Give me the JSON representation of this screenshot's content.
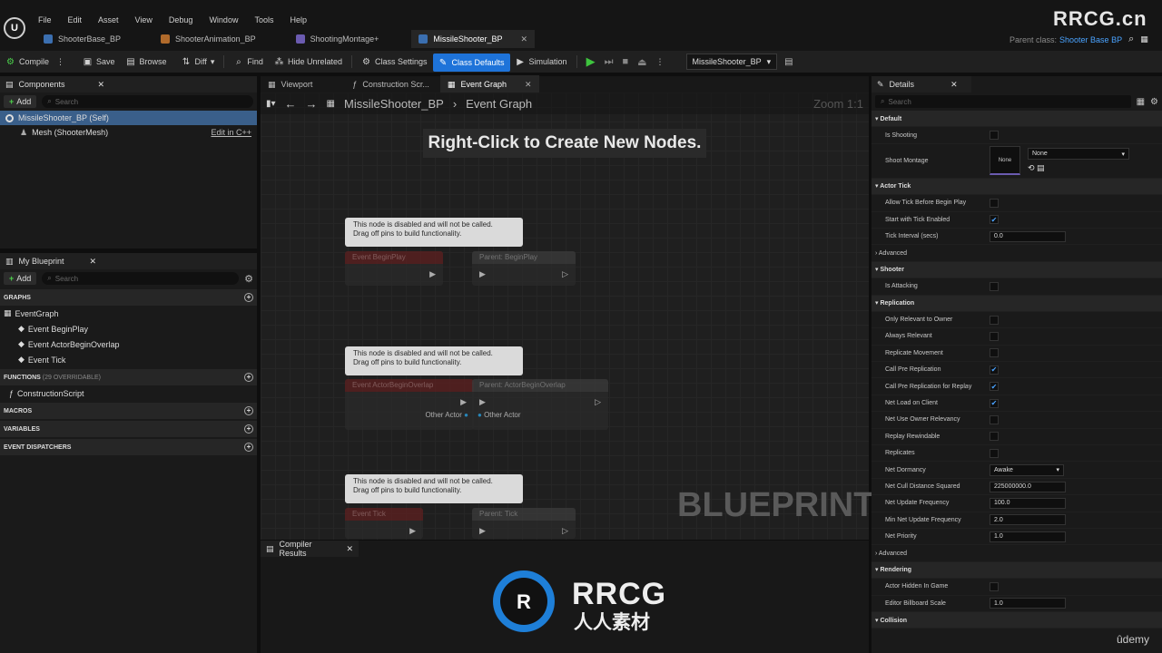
{
  "menu": [
    "File",
    "Edit",
    "Asset",
    "View",
    "Debug",
    "Window",
    "Tools",
    "Help"
  ],
  "tabs": [
    {
      "label": "ShooterBase_BP"
    },
    {
      "label": "ShooterAnimation_BP"
    },
    {
      "label": "ShootingMontage+"
    },
    {
      "label": "MissileShooter_BP"
    }
  ],
  "watermark": "RRCG.cn",
  "parent_class_label": "Parent class:",
  "parent_class_value": "Shooter Base BP",
  "toolbar": {
    "compile": "Compile",
    "save": "Save",
    "browse": "Browse",
    "diff": "Diff",
    "find": "Find",
    "hide_unrelated": "Hide Unrelated",
    "class_settings": "Class Settings",
    "class_defaults": "Class Defaults",
    "simulation": "Simulation",
    "debug_target": "MissileShooter_BP"
  },
  "components": {
    "title": "Components",
    "add": "Add",
    "search_placeholder": "Search",
    "self": "MissileShooter_BP (Self)",
    "mesh": "Mesh (ShooterMesh)",
    "edit_cpp": "Edit in C++"
  },
  "my_blueprint": {
    "title": "My Blueprint",
    "add": "Add",
    "search_placeholder": "Search",
    "graphs": "GRAPHS",
    "event_graph": "EventGraph",
    "events": [
      "Event BeginPlay",
      "Event ActorBeginOverlap",
      "Event Tick"
    ],
    "functions": "FUNCTIONS",
    "functions_note": "(29 OVERRIDABLE)",
    "construction_script": "ConstructionScript",
    "macros": "MACROS",
    "variables": "VARIABLES",
    "event_dispatchers": "EVENT DISPATCHERS"
  },
  "editor_tabs": {
    "viewport": "Viewport",
    "construction": "Construction Scr...",
    "event_graph": "Event Graph"
  },
  "breadcrumb": {
    "bp": "MissileShooter_BP",
    "graph": "Event Graph"
  },
  "zoom": "Zoom 1:1",
  "hint": "Right-Click to Create New Nodes.",
  "graph_watermark": "BLUEPRINT",
  "disabled_note_1": "This node is disabled and will not be called.",
  "disabled_note_2": "Drag off pins to build functionality.",
  "nodes": {
    "begin": "Event BeginPlay",
    "parent_begin": "Parent: BeginPlay",
    "overlap": "Event ActorBeginOverlap",
    "parent_overlap": "Parent: ActorBeginOverlap",
    "other_actor": "Other Actor",
    "tick": "Event Tick",
    "parent_tick": "Parent: Tick"
  },
  "compiler_results": "Compiler Results",
  "details": {
    "title": "Details",
    "search_placeholder": "Search",
    "rows": [
      {
        "type": "sec",
        "label": "Default"
      },
      {
        "type": "cb",
        "label": "Is Shooting",
        "checked": false
      },
      {
        "type": "montage",
        "label": "Shoot Montage",
        "thumb": "None",
        "value": "None"
      },
      {
        "type": "sec",
        "label": "Actor Tick"
      },
      {
        "type": "cb",
        "label": "Allow Tick Before Begin Play",
        "checked": false
      },
      {
        "type": "cb",
        "label": "Start with Tick Enabled",
        "checked": true
      },
      {
        "type": "num",
        "label": "Tick Interval (secs)",
        "value": "0.0"
      },
      {
        "type": "sub",
        "label": "Advanced"
      },
      {
        "type": "sec",
        "label": "Shooter"
      },
      {
        "type": "cb",
        "label": "Is Attacking",
        "checked": false
      },
      {
        "type": "sec",
        "label": "Replication"
      },
      {
        "type": "cb",
        "label": "Only Relevant to Owner",
        "checked": false
      },
      {
        "type": "cb",
        "label": "Always Relevant",
        "checked": false
      },
      {
        "type": "cb",
        "label": "Replicate Movement",
        "checked": false
      },
      {
        "type": "cb",
        "label": "Call Pre Replication",
        "checked": true
      },
      {
        "type": "cb",
        "label": "Call Pre Replication for Replay",
        "checked": true
      },
      {
        "type": "cb",
        "label": "Net Load on Client",
        "checked": true
      },
      {
        "type": "cb",
        "label": "Net Use Owner Relevancy",
        "checked": false
      },
      {
        "type": "cb",
        "label": "Replay Rewindable",
        "checked": false
      },
      {
        "type": "cb",
        "label": "Replicates",
        "checked": false
      },
      {
        "type": "sel",
        "label": "Net Dormancy",
        "value": "Awake"
      },
      {
        "type": "num",
        "label": "Net Cull Distance Squared",
        "value": "225000000.0"
      },
      {
        "type": "num",
        "label": "Net Update Frequency",
        "value": "100.0"
      },
      {
        "type": "num",
        "label": "Min Net Update Frequency",
        "value": "2.0"
      },
      {
        "type": "num",
        "label": "Net Priority",
        "value": "1.0"
      },
      {
        "type": "sub",
        "label": "Advanced"
      },
      {
        "type": "sec",
        "label": "Rendering"
      },
      {
        "type": "cb",
        "label": "Actor Hidden In Game",
        "checked": false
      },
      {
        "type": "num",
        "label": "Editor Billboard Scale",
        "value": "1.0"
      },
      {
        "type": "sec",
        "label": "Collision"
      }
    ]
  },
  "brand": {
    "big": "RRCG",
    "sub": "人人素材"
  },
  "udemy": "ûdemy"
}
